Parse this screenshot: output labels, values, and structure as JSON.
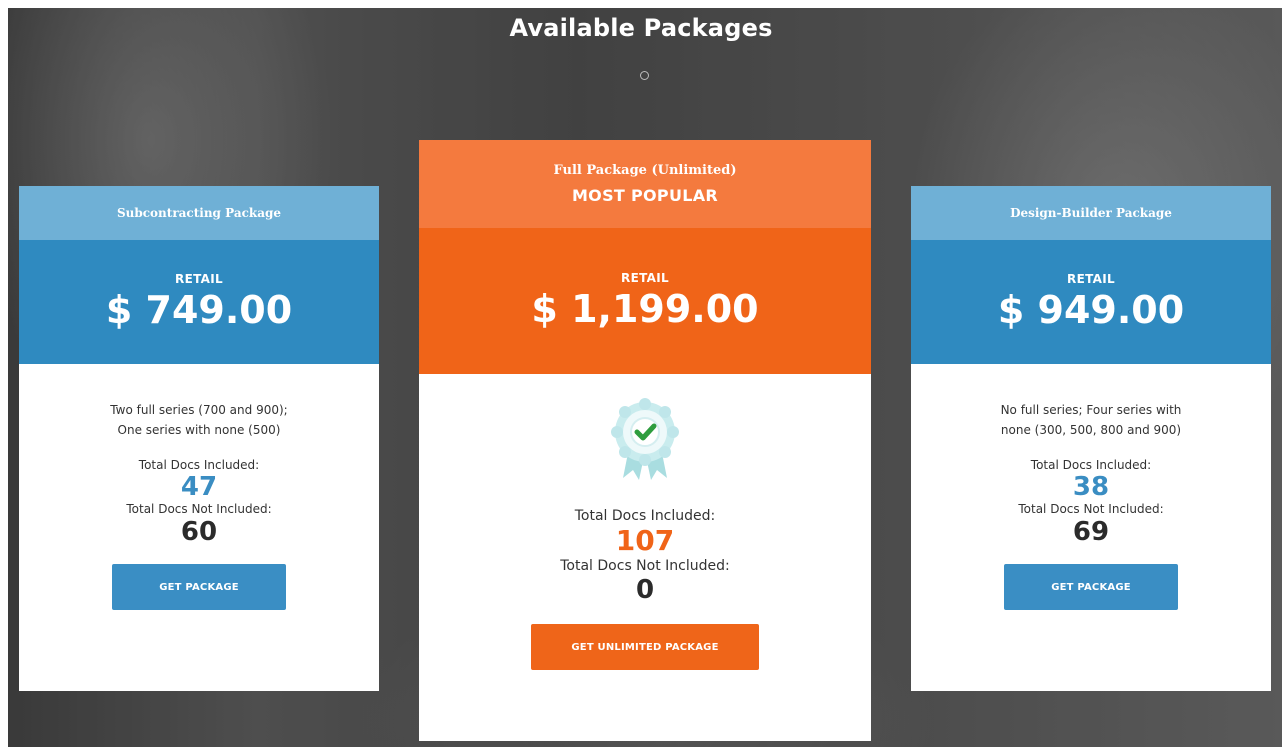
{
  "page": {
    "title": "Available Packages"
  },
  "packages": [
    {
      "name": "Subcontracting Package",
      "price_label": "RETAIL",
      "price": "$ 749.00",
      "description_line1": "Two full series (700 and 900);",
      "description_line2": "One series with none (500)",
      "included_label": "Total Docs Included:",
      "included_count": "47",
      "not_included_label": "Total Docs Not Included:",
      "not_included_count": "60",
      "button_label": "GET PACKAGE",
      "accent": "#2f8ac0"
    },
    {
      "name": "Full Package (Unlimited)",
      "badge": "MOST POPULAR",
      "price_label": "RETAIL",
      "price": "$ 1,199.00",
      "icon": "award-check-icon",
      "included_label": "Total Docs Included:",
      "included_count": "107",
      "not_included_label": "Total Docs Not Included:",
      "not_included_count": "0",
      "button_label": "GET UNLIMITED PACKAGE",
      "accent": "#f06418"
    },
    {
      "name": "Design-Builder Package",
      "price_label": "RETAIL",
      "price": "$ 949.00",
      "description_line1": "No full series; Four series with",
      "description_line2": "none (300, 500, 800 and 900)",
      "included_label": "Total Docs Included:",
      "included_count": "38",
      "not_included_label": "Total Docs Not Included:",
      "not_included_count": "69",
      "button_label": "GET PACKAGE",
      "accent": "#2f8ac0"
    }
  ]
}
